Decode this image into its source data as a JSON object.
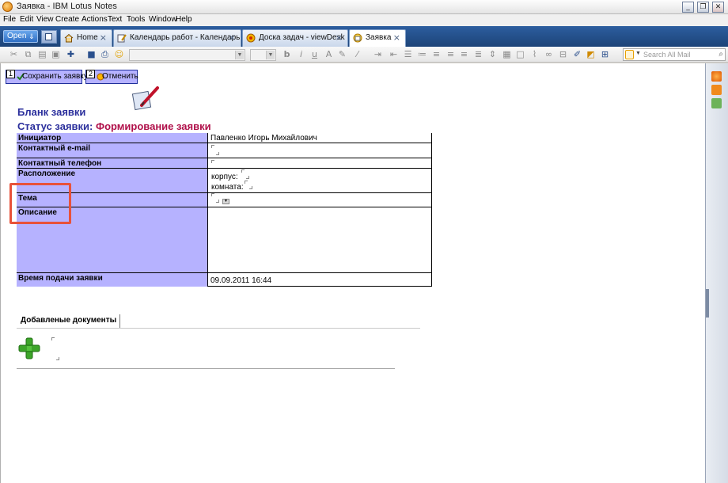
{
  "window": {
    "title": "Заявка - IBM Lotus Notes"
  },
  "menu": [
    "File",
    "Edit",
    "View",
    "Create",
    "Actions",
    "Text",
    "Tools",
    "Window",
    "Help"
  ],
  "tabs": {
    "open_label": "Open",
    "items": [
      {
        "label": "Home",
        "icon": "home-icon"
      },
      {
        "label": "Календарь работ - Календарь",
        "icon": "pencil-icon"
      },
      {
        "label": "Доска задач - viewDesk",
        "icon": "database-icon"
      },
      {
        "label": "Заявка",
        "icon": "form-icon",
        "active": true
      }
    ],
    "close_glyph": "×"
  },
  "toolbar": {
    "search_placeholder": "Search All Mail",
    "icons": [
      "cut-icon",
      "copy-icon",
      "paste-icon",
      "print-preview-icon",
      "new-icon",
      "save-icon",
      "print-icon",
      "emoticon-icon",
      "bold-icon",
      "italic-icon",
      "underline-icon",
      "text-color-icon",
      "highlight-icon",
      "text-pen-icon",
      "indent-icon",
      "bullets-icon",
      "numbering-icon",
      "align-left-icon",
      "align-center-icon",
      "align-right-icon",
      "align-justify-icon",
      "spacing-icon",
      "table-icon",
      "attach-icon",
      "link-icon",
      "image-icon",
      "format-painter-icon",
      "pen-icon",
      "style-icon"
    ]
  },
  "actions": [
    {
      "number": "1",
      "label": "Сохранить заявку",
      "icon": "save-check-icon"
    },
    {
      "number": "2",
      "label": "Отменить",
      "icon": "cancel-icon"
    }
  ],
  "form": {
    "title": "Бланк заявки",
    "status_label": "Статус заявки:",
    "status_value": "Формирование заявки",
    "fields": {
      "initiator_label": "Инициатор",
      "initiator_value": "Павленко Игорь Михайлович",
      "email_label": "Контактный e-mail",
      "phone_label": "Контактный телефон",
      "location_label": "Расположение",
      "building_label": "корпус:",
      "room_label": "комната:",
      "subject_label": "Тема",
      "description_label": "Описание",
      "submit_time_label": "Время подачи заявки",
      "submit_time_value": "09.09.2011 16:44"
    }
  },
  "attachments": {
    "tab_label": "Добавленые документы"
  },
  "colors": {
    "label_bg": "#b6b2ff",
    "title_blue": "#2b2f9c",
    "status_red": "#b0104a",
    "highlight": "#e8523a",
    "tabstrip": "#2d5e9f"
  }
}
